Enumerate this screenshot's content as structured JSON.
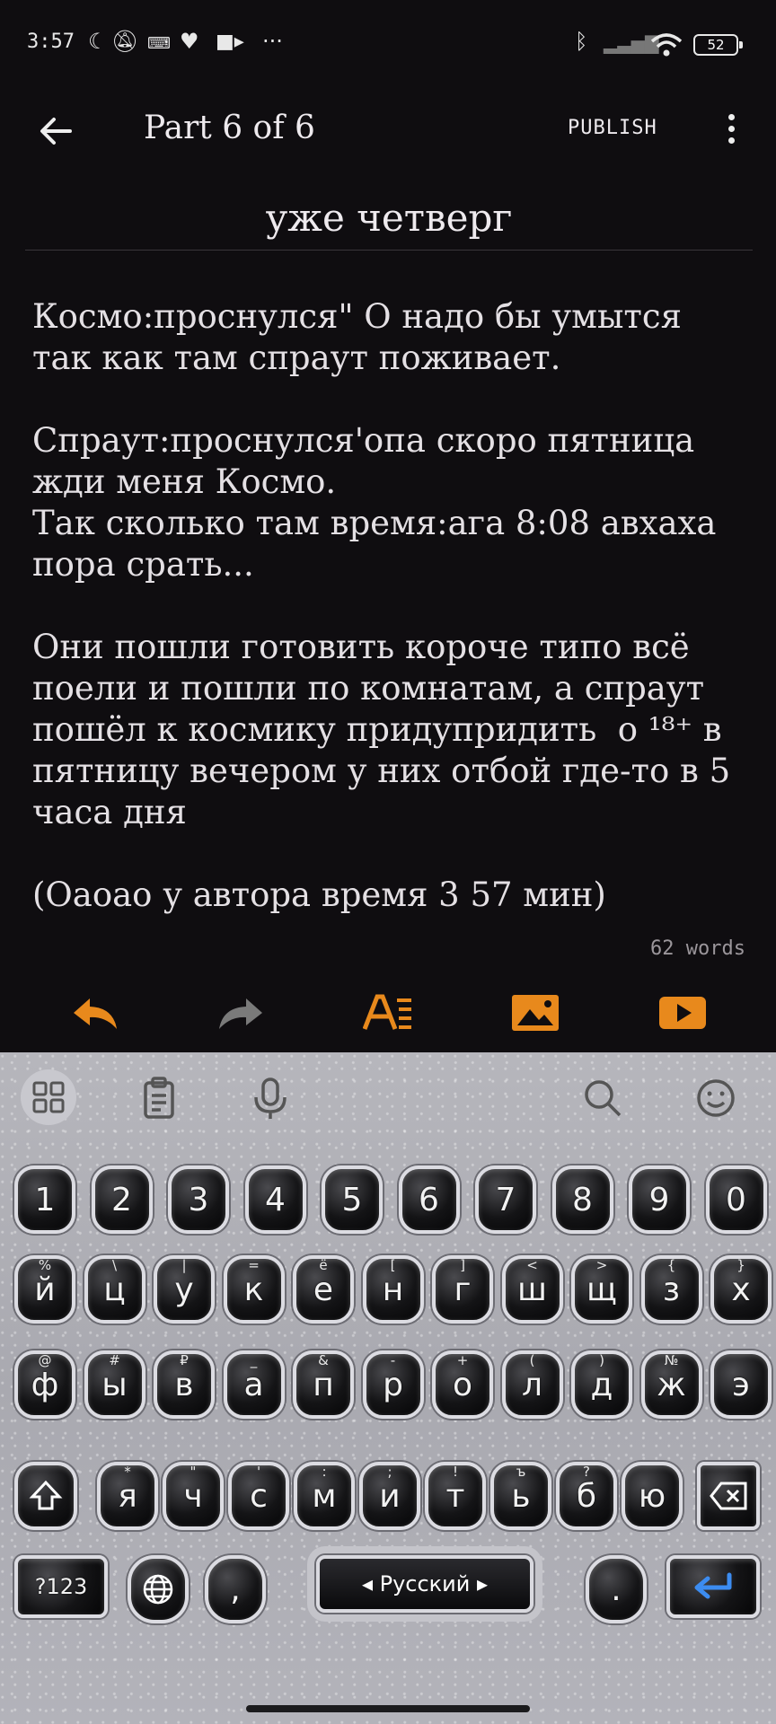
{
  "status_bar": {
    "time": "3:57",
    "battery": "52",
    "icons": [
      "moon-icon",
      "bell-off-icon",
      "keyboard-icon",
      "heart-icon",
      "video-icon",
      "more-icon",
      "bluetooth-icon",
      "signal-icon",
      "wifi-icon",
      "battery-icon"
    ],
    "overflow": "···"
  },
  "app_bar": {
    "title": "Part 6 of 6",
    "publish_label": "PUBLISH"
  },
  "chapter_title": "уже четверг",
  "story_text": "Космо:проснулся\" О надо бы умытся так как там спраут поживает.\n\nСпраут:проснулся'опа скоро пятница жди меня Космо.\nТак сколько там время:ага 8:08 авхаха пора срать...\n\nОни пошли готовить короче типо всё поели и пошли по комнатам, а спраут пошёл к космику придупридить  о ¹⁸⁺ в пятницу вечером у них отбой где-то в 5 часа дня\n\n(Оаоао у автора время 3 57 мин)",
  "word_count": "62 words",
  "toolbar": {
    "accent": "#e8891c",
    "icons": [
      "undo-icon",
      "redo-icon",
      "text-format-icon",
      "image-icon",
      "video-icon"
    ]
  },
  "keyboard": {
    "suggestion_icons": [
      "apps-grid-icon",
      "clipboard-icon",
      "microphone-icon",
      "search-icon",
      "emoji-icon"
    ],
    "number_row": [
      "1",
      "2",
      "3",
      "4",
      "5",
      "6",
      "7",
      "8",
      "9",
      "0"
    ],
    "row1": [
      {
        "k": "й",
        "s": "%"
      },
      {
        "k": "ц",
        "s": "\\"
      },
      {
        "k": "у",
        "s": "|"
      },
      {
        "k": "к",
        "s": "="
      },
      {
        "k": "е",
        "s": "ё"
      },
      {
        "k": "н",
        "s": "["
      },
      {
        "k": "г",
        "s": "]"
      },
      {
        "k": "ш",
        "s": "<"
      },
      {
        "k": "щ",
        "s": ">"
      },
      {
        "k": "з",
        "s": "{"
      },
      {
        "k": "х",
        "s": "}"
      }
    ],
    "row2": [
      {
        "k": "ф",
        "s": "@"
      },
      {
        "k": "ы",
        "s": "#"
      },
      {
        "k": "в",
        "s": "₽"
      },
      {
        "k": "а",
        "s": "_"
      },
      {
        "k": "п",
        "s": "&"
      },
      {
        "k": "р",
        "s": "-"
      },
      {
        "k": "о",
        "s": "+"
      },
      {
        "k": "л",
        "s": "("
      },
      {
        "k": "д",
        "s": ")"
      },
      {
        "k": "ж",
        "s": "№"
      },
      {
        "k": "э",
        "s": ""
      }
    ],
    "row3": [
      {
        "k": "я",
        "s": "*"
      },
      {
        "k": "ч",
        "s": "\""
      },
      {
        "k": "с",
        "s": "'"
      },
      {
        "k": "м",
        "s": ":"
      },
      {
        "k": "и",
        "s": ";"
      },
      {
        "k": "т",
        "s": "!"
      },
      {
        "k": "ь",
        "s": "ъ"
      },
      {
        "k": "б",
        "s": "?"
      },
      {
        "k": "ю",
        "s": ""
      }
    ],
    "symbols_label": "?123",
    "comma_label": ",",
    "space_label": "◂ Русский ▸",
    "period_label": "."
  }
}
